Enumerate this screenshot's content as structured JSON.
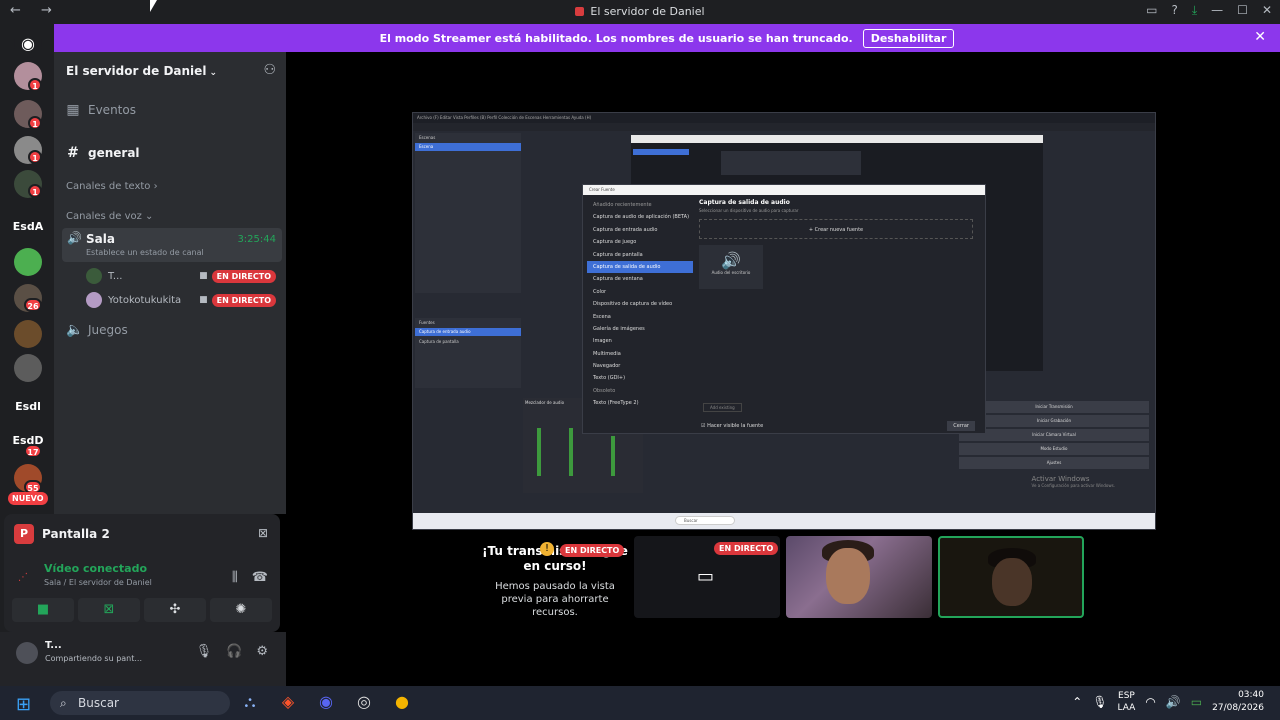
{
  "titlebar": {
    "title": "El servidor de Daniel"
  },
  "banner": {
    "message": "El modo Streamer está habilitado. Los nombres de usuario se han truncado.",
    "button": "Deshabilitar"
  },
  "servers": {
    "badges": [
      "1",
      "1",
      "1",
      "1",
      "1",
      "26",
      "17",
      "55"
    ],
    "labels": [
      "EsdA",
      "Esdl",
      "EsdD"
    ],
    "new_label": "NUEVO"
  },
  "sidebar": {
    "server_name": "El servidor de Daniel",
    "events": "Eventos",
    "general": "general",
    "text_category": "Canales de texto",
    "voice_category": "Canales de voz",
    "voice_channel": {
      "name": "Sala",
      "time": "3:25:44",
      "status": "Establece un estado de canal"
    },
    "users": [
      {
        "name": "T...",
        "live": "EN DIRECTO"
      },
      {
        "name": "Yotokotukukita",
        "live": "EN DIRECTO"
      }
    ],
    "juegos": "Juegos"
  },
  "voice_panel": {
    "screen": "Pantalla 2",
    "screen_letter": "P",
    "connected": "Vídeo conectado",
    "location": "Sala / El servidor de Daniel"
  },
  "userbar": {
    "name": "T...",
    "status": "Compartiendo su pant..."
  },
  "obs": {
    "menubar": "Archivo (F)   Editar   Vista   Perfiles (B)   Perfil   Colección de Escenas   Herramientas   Ayuda (H)",
    "scenes_title": "Escenas",
    "scene": "Escena",
    "sources_title": "Fuentes",
    "source_selected": "Captura de entrada audio",
    "source2": "Captura de pantalla",
    "mixer_title": "Mezclador de audio",
    "controls": [
      "Iniciar Transmisión",
      "Iniciar Grabación",
      "Iniciar Cámara Virtual",
      "Modo Estudio",
      "Ajustes"
    ],
    "watermark_1": "Activar Windows",
    "watermark_2": "Ve a Configuración para activar Windows.",
    "taskbar_search": "Buscar"
  },
  "dialog": {
    "title": "Crear Fuente",
    "recent_header": "Añadido recientemente",
    "items": [
      "Captura de audio de aplicación (BETA)",
      "Captura de entrada audio",
      "Captura de juego",
      "Captura de pantalla",
      "Captura de salida de audio",
      "Captura de ventana",
      "Color",
      "Dispositivo de captura de vídeo",
      "Escena",
      "Galería de imágenes",
      "Imagen",
      "Multimedia",
      "Navegador",
      "Texto (GDI+)",
      "Obsoleto",
      "Texto (FreeType 2)"
    ],
    "right_title": "Captura de salida de audio",
    "right_sub": "Seleccionar un dispositivo de audio para capturar",
    "new_source": "Crear nueva fuente",
    "tile_label": "Audio del escritorio",
    "add_button": "Add existing",
    "checkbox": "Hacer visible la fuente",
    "close": "Cerrar"
  },
  "stream": {
    "live": "EN DIRECTO",
    "paused_title": "¡Tu transmisión sigue en curso!",
    "paused_text": "Hemos pausado la vista previa para ahorrarte recursos."
  },
  "taskbar": {
    "search": "Buscar",
    "lang_1": "ESP",
    "lang_2": "LAA",
    "time": "03:40",
    "date": "27/08/2026"
  }
}
